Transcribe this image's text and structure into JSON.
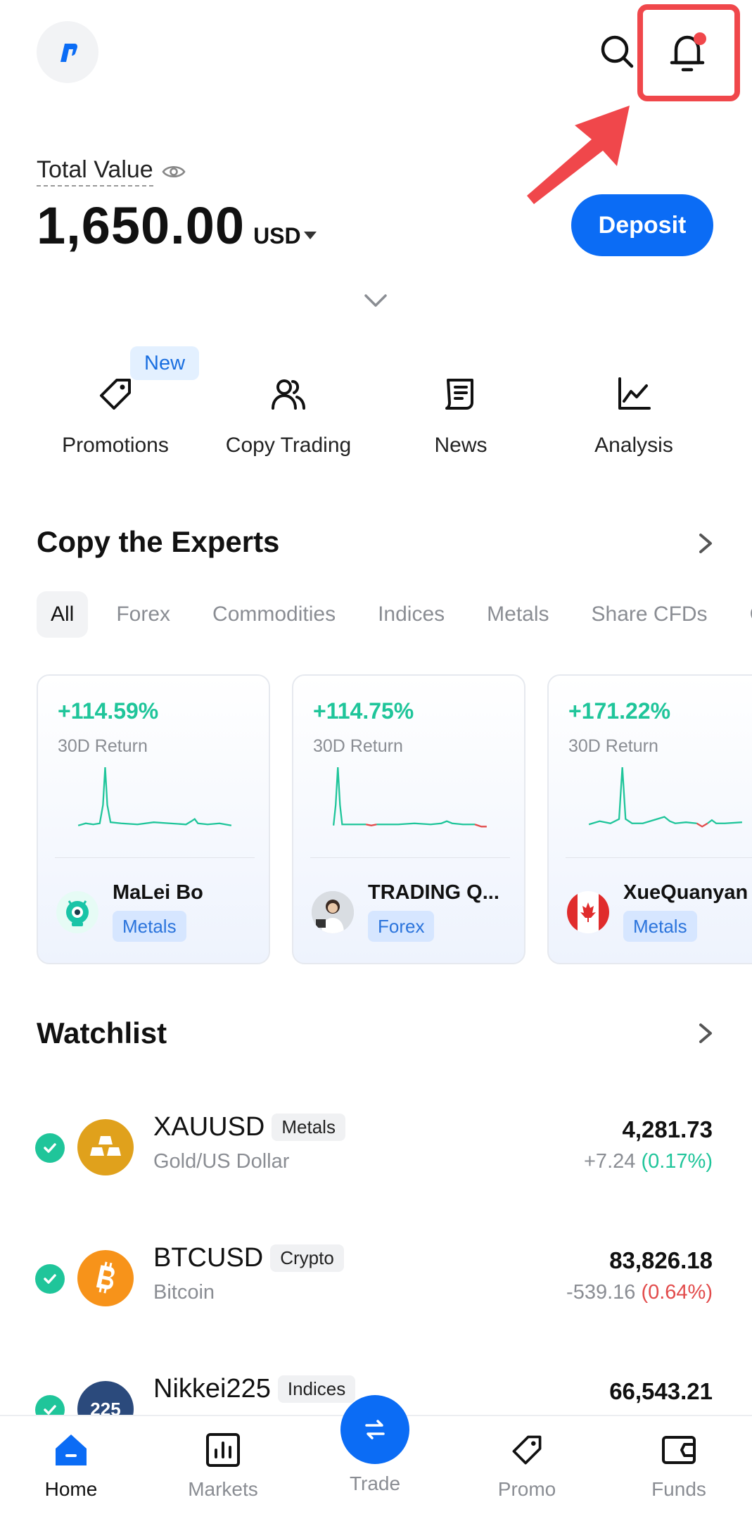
{
  "header": {
    "logo_icon": "app-logo",
    "search_icon": "search-icon",
    "bell_icon": "bell-icon",
    "notification_dot_color": "#f0474b"
  },
  "total_value": {
    "label": "Total Value",
    "amount": "1,650.00",
    "currency": "USD",
    "deposit_label": "Deposit"
  },
  "quick_actions": {
    "new_badge": "New",
    "items": [
      {
        "label": "Promotions",
        "icon": "tag-icon"
      },
      {
        "label": "Copy Trading",
        "icon": "users-icon"
      },
      {
        "label": "News",
        "icon": "news-icon"
      },
      {
        "label": "Analysis",
        "icon": "chart-line-icon"
      }
    ]
  },
  "copy_experts": {
    "title": "Copy the Experts",
    "tabs": [
      "All",
      "Forex",
      "Commodities",
      "Indices",
      "Metals",
      "Share CFDs",
      "C"
    ],
    "active_tab": "All",
    "cards": [
      {
        "return": "+114.59%",
        "period": "30D Return",
        "name": "MaLei Bo",
        "tag": "Metals"
      },
      {
        "return": "+114.75%",
        "period": "30D Return",
        "name": "TRADING Q...",
        "tag": "Forex"
      },
      {
        "return": "+171.22%",
        "period": "30D Return",
        "name": "XueQuanyan",
        "tag": "Metals"
      }
    ]
  },
  "watchlist": {
    "title": "Watchlist",
    "items": [
      {
        "symbol": "XAUUSD",
        "category": "Metals",
        "name": "Gold/US Dollar",
        "price": "4,281.73",
        "change": "+7.24",
        "change_pct": "(0.17%)",
        "direction": "up"
      },
      {
        "symbol": "BTCUSD",
        "category": "Crypto",
        "name": "Bitcoin",
        "price": "83,826.18",
        "change": "-539.16",
        "change_pct": "(0.64%)",
        "direction": "down"
      },
      {
        "symbol": "Nikkei225",
        "category": "Indices",
        "name": "",
        "price": "66,543.21",
        "change": "",
        "change_pct": "",
        "direction": "up",
        "logo_text": "225"
      }
    ]
  },
  "bottom_nav": {
    "items": [
      {
        "label": "Home",
        "icon": "home-icon",
        "active": true
      },
      {
        "label": "Markets",
        "icon": "bar-chart-icon",
        "active": false
      },
      {
        "label": "Trade",
        "icon": "swap-icon",
        "active": false
      },
      {
        "label": "Promo",
        "icon": "tag-icon",
        "active": false
      },
      {
        "label": "Funds",
        "icon": "wallet-icon",
        "active": false
      }
    ]
  },
  "colors": {
    "accent": "#0b6cf5",
    "positive": "#1fc59a",
    "negative": "#e24b4b",
    "annotation": "#f0474b"
  }
}
